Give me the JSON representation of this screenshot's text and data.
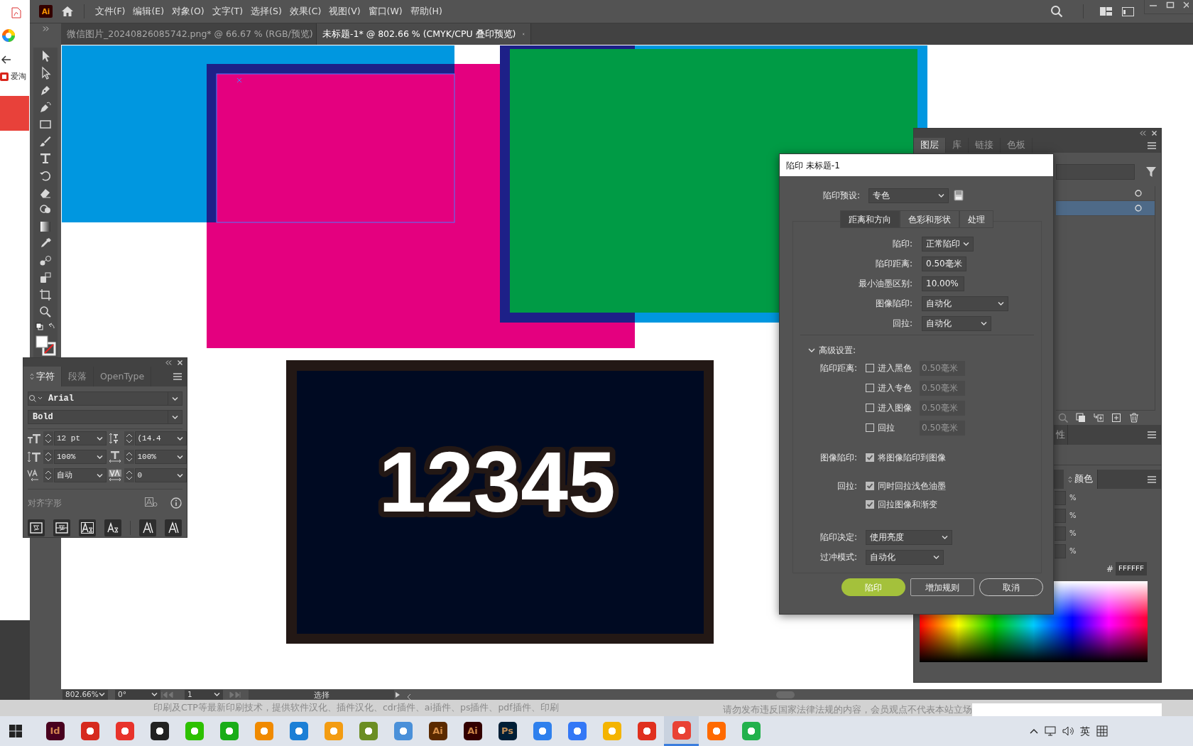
{
  "browser_strip": {
    "text": "爱淘"
  },
  "app": {
    "logo": "Ai",
    "menu": [
      "文件(F)",
      "编辑(E)",
      "对象(O)",
      "文字(T)",
      "选择(S)",
      "效果(C)",
      "视图(V)",
      "窗口(W)",
      "帮助(H)"
    ]
  },
  "document_tabs": [
    {
      "label": "微信图片_20240826085742.png* @ 66.67 % (RGB/预览)",
      "selected": false
    },
    {
      "label": "未标题-1* @ 802.66 % (CMYK/CPU 叠印预览)",
      "selected": true
    }
  ],
  "artwork": {
    "number": "12345"
  },
  "character_panel": {
    "tabs": [
      {
        "label": "字符",
        "selected": true
      },
      {
        "label": "段落",
        "selected": false
      },
      {
        "label": "OpenType",
        "selected": false
      }
    ],
    "font": "Arial",
    "style": "Bold",
    "fields": [
      {
        "value": "12 pt"
      },
      {
        "value": "(14.4"
      },
      {
        "value": "100%"
      },
      {
        "value": "100%"
      },
      {
        "value": "自动"
      },
      {
        "value": "0"
      }
    ],
    "section": "对齐字形"
  },
  "right_panel": {
    "tabs": [
      {
        "label": "图层",
        "selected": true
      },
      {
        "label": "库",
        "selected": false
      },
      {
        "label": "链接",
        "selected": false
      },
      {
        "label": "色板",
        "selected": false
      }
    ],
    "layers": [
      {
        "selected": false
      },
      {
        "selected": true
      }
    ],
    "properties_tab": "性",
    "color_tab": "颜色",
    "units": [
      "%",
      "%",
      "%",
      "%"
    ],
    "hash": "#",
    "hex": "FFFFFF"
  },
  "trap_dialog": {
    "title": "陷印 未标题-1",
    "preset": {
      "label": "陷印预设:",
      "value": "专色"
    },
    "tabs": [
      {
        "label": "距离和方向",
        "selected": true
      },
      {
        "label": "色彩和形状",
        "selected": false
      },
      {
        "label": "处理",
        "selected": false
      }
    ],
    "fields": [
      {
        "kind": "select",
        "label": "陷印:",
        "value": "正常陷印"
      },
      {
        "kind": "input",
        "label": "陷印距离:",
        "value": "0.50毫米"
      },
      {
        "kind": "input",
        "label": "最小油墨区别:",
        "value": "10.00%"
      },
      {
        "kind": "select",
        "label": "图像陷印:",
        "value": "自动化"
      },
      {
        "kind": "select",
        "label": "回拉:",
        "value": "自动化"
      }
    ],
    "advanced": {
      "label": "高级设置:",
      "expanded": true,
      "distance_label": "陷印距离:",
      "options": [
        {
          "label": "进入黑色",
          "checked": false,
          "value": "0.50毫米"
        },
        {
          "label": "进入专色",
          "checked": false,
          "value": "0.50毫米"
        },
        {
          "label": "进入图像",
          "checked": false,
          "value": "0.50毫米"
        },
        {
          "label": "回拉",
          "checked": false,
          "value": "0.50毫米"
        }
      ]
    },
    "image_trap": {
      "label": "图像陷印:",
      "options": [
        {
          "label": "将图像陷印到图像",
          "checked": true
        }
      ]
    },
    "pullback": {
      "label": "回拉:",
      "options": [
        {
          "label": "同时回拉浅色油墨",
          "checked": true
        },
        {
          "label": "回拉图像和渐变",
          "checked": true
        }
      ]
    },
    "decision": {
      "label": "陷印决定:",
      "value": "使用亮度"
    },
    "overprint": {
      "label": "过冲模式:",
      "value": "自动化"
    },
    "buttons": [
      {
        "label": "陷印",
        "kind": "primary"
      },
      {
        "label": "增加规则",
        "kind": "default"
      },
      {
        "label": "取消",
        "kind": "cancel"
      }
    ]
  },
  "status_bar": {
    "zoom": "802.66%",
    "rotation": "0°",
    "artboard": "1",
    "tool": "选择"
  },
  "web_strip": {
    "left": "印刷及CTP等最新印刷技术，提供软件汉化、插件汉化、cdr插件、ai插件、ps插件、pdf插件、印刷",
    "right": "请勿发布违反国家法律法规的内容，会员观点不代表本站立场"
  },
  "taskbar": {
    "apps": [
      {
        "label": "Id",
        "color": "#49021f",
        "active": false
      },
      {
        "color": "#d62a1e",
        "active": false
      },
      {
        "color": "#e8332b",
        "active": false
      },
      {
        "color": "#222222",
        "active": false
      },
      {
        "color": "#2dc100",
        "active": false
      },
      {
        "color": "#1aad19",
        "active": false
      },
      {
        "color": "#f08a00",
        "active": false
      },
      {
        "color": "#1b7fd6",
        "active": false
      },
      {
        "color": "#f39c12",
        "active": false
      },
      {
        "color": "#6b8e23",
        "active": false
      },
      {
        "color": "#4a90d9",
        "active": false
      },
      {
        "label": "Ai",
        "color": "#5a2a00",
        "active": false
      },
      {
        "label": "Ai",
        "color": "#330000",
        "active": false
      },
      {
        "label": "Ps",
        "color": "#001e36",
        "active": false
      },
      {
        "color": "#2f80ed",
        "active": false
      },
      {
        "color": "#3478f6",
        "active": false
      },
      {
        "color": "#f4b400",
        "active": false
      },
      {
        "color": "#e0301e",
        "active": false
      },
      {
        "color": "#e94235",
        "active": true
      },
      {
        "color": "#ff6a00",
        "active": false
      },
      {
        "color": "#22b14c",
        "active": false
      }
    ],
    "ime": "英"
  }
}
